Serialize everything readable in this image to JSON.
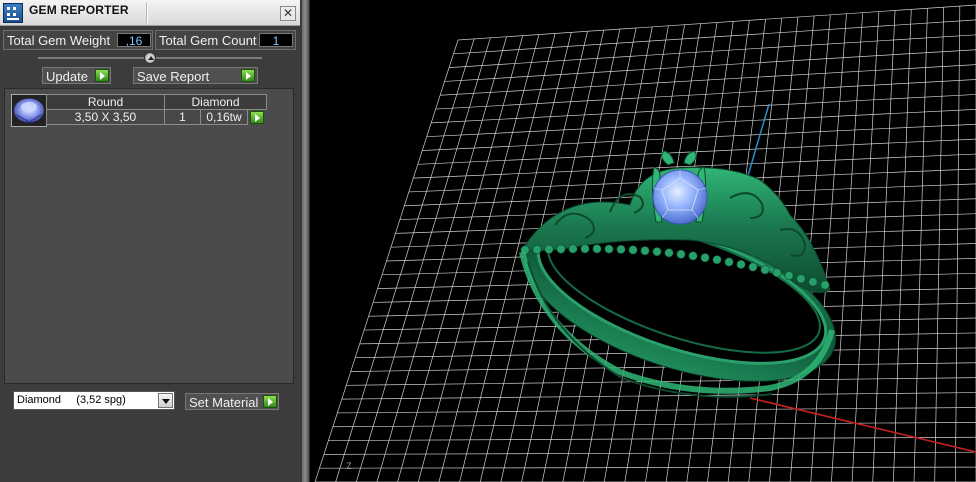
{
  "window": {
    "title": "GEM REPORTER",
    "close_icon": "close-icon",
    "app_icon": "gem-reporter-app-icon"
  },
  "summary": {
    "total_weight_label": "Total Gem Weight",
    "total_weight_value": ",16",
    "total_count_label": "Total Gem Count",
    "total_count_value": "1"
  },
  "toolbar": {
    "update_label": "Update",
    "save_report_label": "Save Report"
  },
  "gem_table": {
    "headers": [
      "Round",
      "Diamond"
    ],
    "rows": [
      {
        "size": "3,50 X 3,50",
        "count": "1",
        "weight": "0,16tw"
      }
    ]
  },
  "material": {
    "selected": "Diamond     (3,52 spg)",
    "set_label": "Set Material"
  },
  "viewport": {
    "model": "tiara ring",
    "gem_color": "#8fb1ff",
    "metal_color": "#1f8a5a",
    "grid_color": "#d8d8d8",
    "axis_x_color": "#c62020",
    "axis_z_color": "#2a8fc9",
    "axis_marker": "Z"
  },
  "colors": {
    "panel_bg": "#3c3c3c",
    "value_text": "#7fc4ff",
    "go_green": "#5cc23a"
  }
}
